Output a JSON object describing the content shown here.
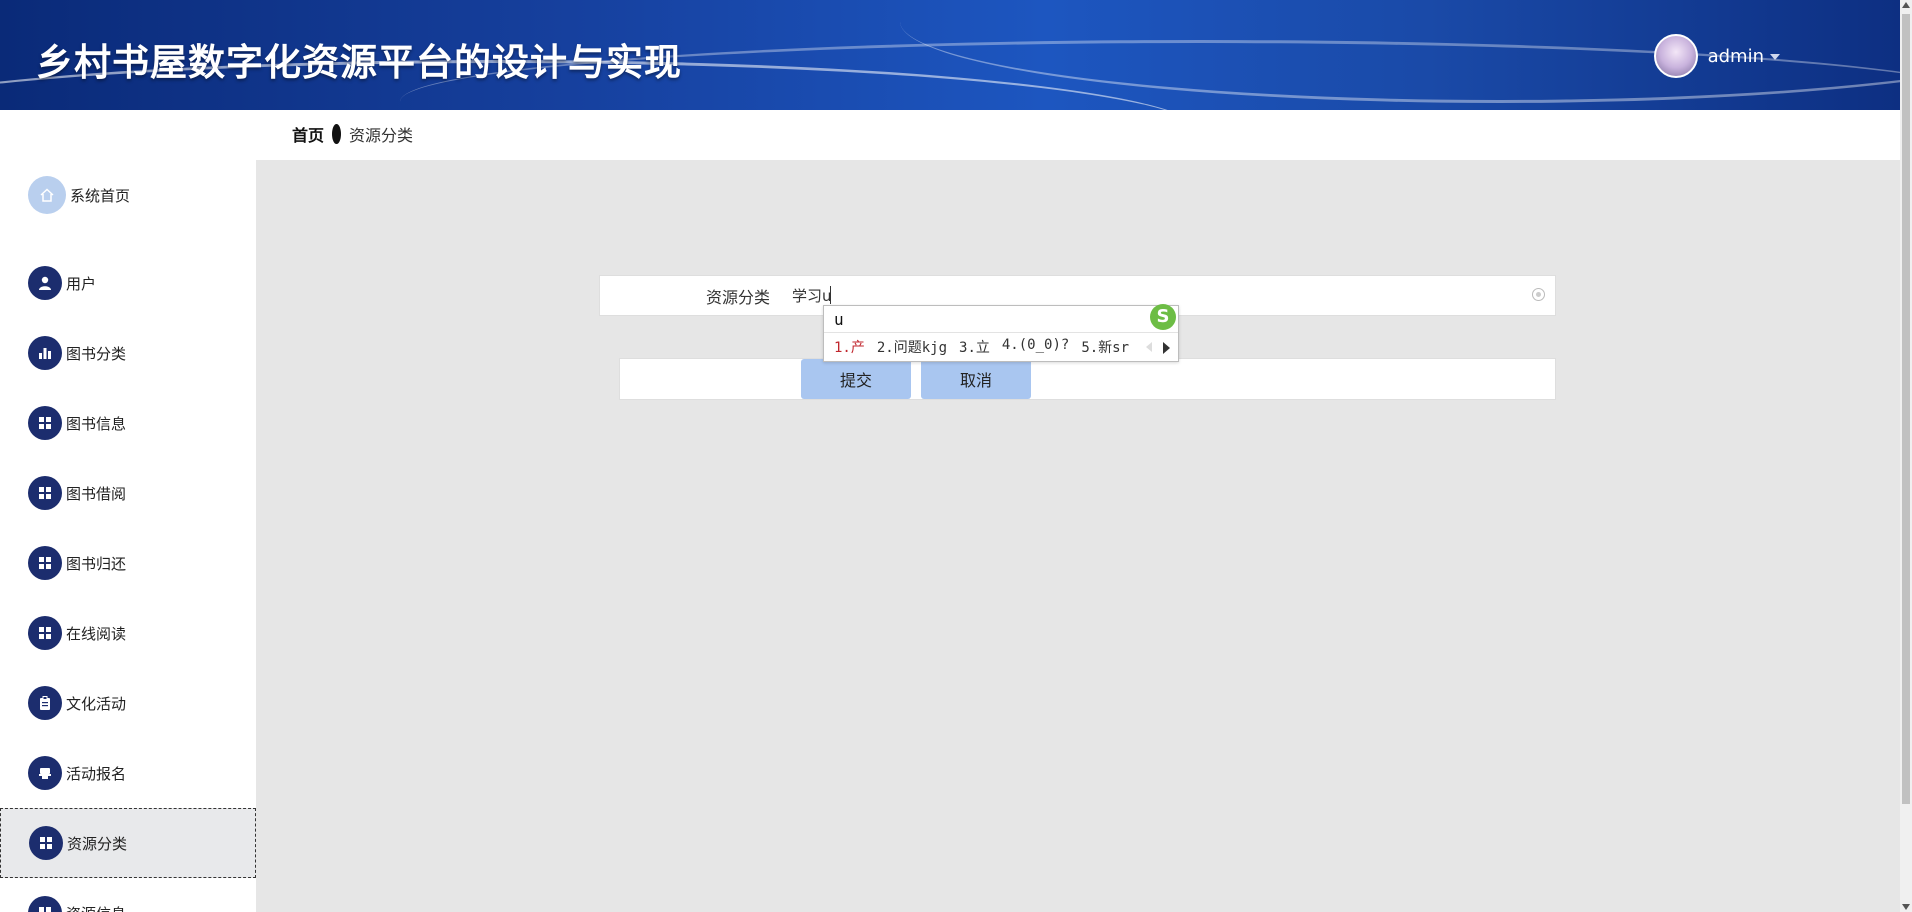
{
  "header": {
    "title": "乡村书屋数字化资源平台的设计与实现",
    "username": "admin",
    "avatar_icon": "avatar-icon",
    "dropdown_icon": "caret-down-icon"
  },
  "breadcrumb": {
    "home": "首页",
    "current": "资源分类"
  },
  "sidebar": {
    "items": [
      {
        "label": "系统首页",
        "icon": "home-icon"
      },
      {
        "label": "用户",
        "icon": "user-icon"
      },
      {
        "label": "图书分类",
        "icon": "bar-chart-icon"
      },
      {
        "label": "图书信息",
        "icon": "grid-icon"
      },
      {
        "label": "图书借阅",
        "icon": "grid-icon"
      },
      {
        "label": "图书归还",
        "icon": "grid-icon"
      },
      {
        "label": "在线阅读",
        "icon": "grid-icon"
      },
      {
        "label": "文化活动",
        "icon": "clipboard-icon"
      },
      {
        "label": "活动报名",
        "icon": "printer-icon"
      },
      {
        "label": "资源分类",
        "icon": "grid-icon"
      },
      {
        "label": "资源信息",
        "icon": "grid-icon"
      }
    ],
    "active": "资源分类"
  },
  "form": {
    "field_label": "资源分类",
    "field_value": "学习u",
    "submit_label": "提交",
    "cancel_label": "取消"
  },
  "ime": {
    "composition": "u",
    "candidates": [
      "1.产",
      "2.问题kjg",
      "3.立",
      "4.(0_0)?",
      "5.新sr"
    ],
    "logo": "S"
  },
  "colors": {
    "header_bg": "#16409e",
    "sidebar_icon_bg": "#1c2d6e",
    "button_bg": "#a9c6f0",
    "ime_highlight": "#c0262d"
  }
}
